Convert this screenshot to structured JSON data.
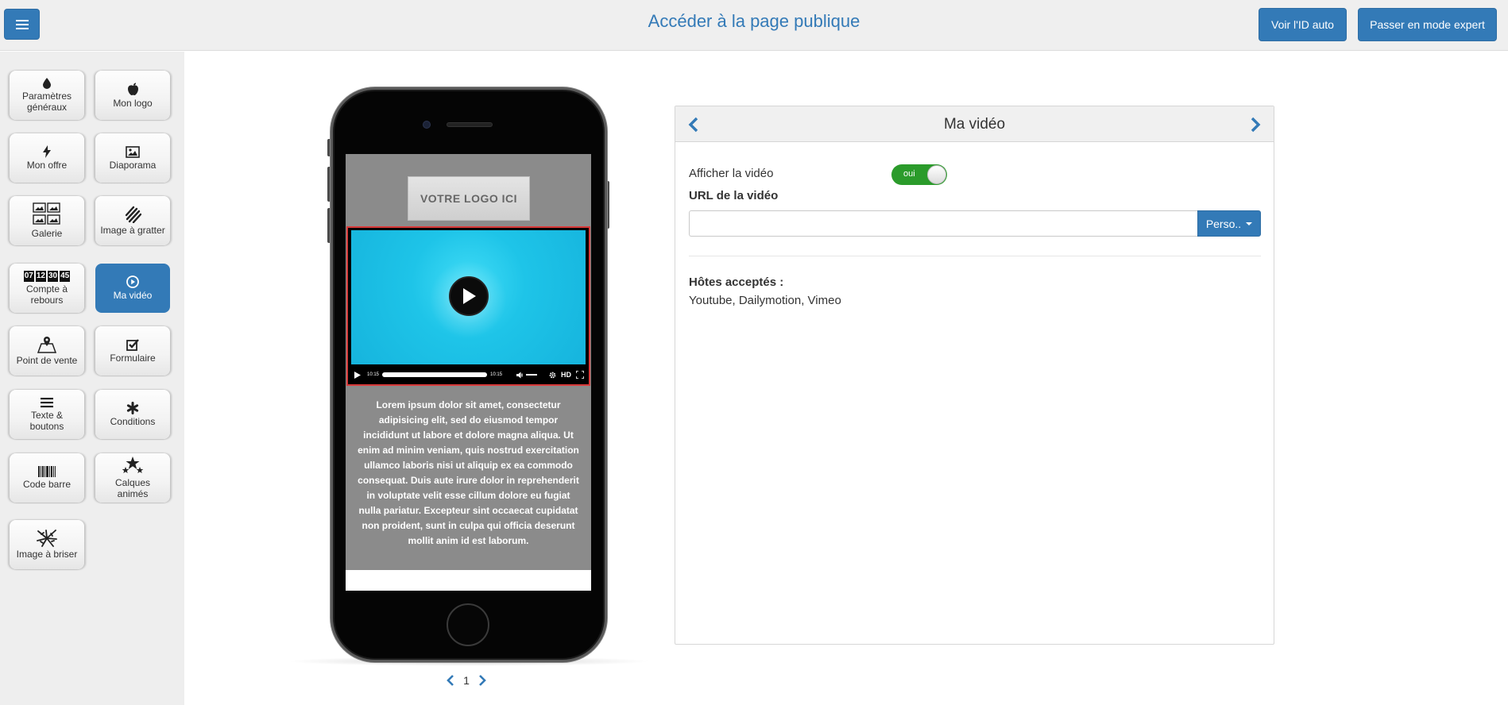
{
  "topbar": {
    "public_link": "Accéder à la page publique",
    "btn_id_auto": "Voir l'ID auto",
    "btn_expert": "Passer en mode expert"
  },
  "sidebar": {
    "items": [
      {
        "label": "Paramètres généraux",
        "icon": "drop-icon"
      },
      {
        "label": "Mon logo",
        "icon": "apple-icon"
      },
      {
        "label": "Mon offre",
        "icon": "bolt-icon"
      },
      {
        "label": "Diaporama",
        "icon": "picture-icon"
      },
      {
        "label": "Galerie",
        "icon": "gallery-icon"
      },
      {
        "label": "Image à gratter",
        "icon": "scratch-icon"
      },
      {
        "label": "Compte à rebours",
        "icon": "countdown-icon",
        "digits": [
          "07",
          "12",
          "30",
          "45"
        ]
      },
      {
        "label": "Ma vidéo",
        "icon": "play-circle-icon",
        "active": true
      },
      {
        "label": "Point de vente",
        "icon": "map-pin-icon"
      },
      {
        "label": "Formulaire",
        "icon": "checkbox-icon"
      },
      {
        "label": "Texte & boutons",
        "icon": "lines-icon"
      },
      {
        "label": "Conditions",
        "icon": "asterisk-icon"
      },
      {
        "label": "Code barre",
        "icon": "barcode-icon"
      },
      {
        "label": "Calques animés",
        "icon": "stars-icon"
      },
      {
        "label": "Image à briser",
        "icon": "shatter-icon"
      }
    ]
  },
  "preview": {
    "logo_placeholder": "VOTRE LOGO ICI",
    "video_time_current": "10:15",
    "video_time_total": "10:15",
    "video_hd_label": "HD",
    "lorem": "Lorem ipsum dolor sit amet, consectetur adipisicing elit, sed do eiusmod tempor incididunt ut labore et dolore magna aliqua. Ut enim ad minim veniam, quis nostrud exercitation ullamco laboris nisi ut aliquip ex ea commodo consequat. Duis aute irure dolor in reprehenderit in voluptate velit esse cillum dolore eu fugiat nulla pariatur. Excepteur sint occaecat cupidatat non proident, sunt in culpa qui officia deserunt mollit anim id est laborum.",
    "page_number": "1"
  },
  "panel": {
    "title": "Ma vidéo",
    "show_video_label": "Afficher la vidéo",
    "toggle_text": "oui",
    "url_label": "URL de la vidéo",
    "url_value": "",
    "perso_label": "Perso..",
    "hosts_title": "Hôtes acceptés :",
    "hosts_list": "Youtube, Dailymotion, Vimeo"
  },
  "colors": {
    "primary": "#337ab7",
    "toggle_on": "#2b9b2b",
    "video_bg": "#1ec4e8",
    "video_border": "#d93a3a",
    "preview_bg": "#8b8b8b"
  }
}
